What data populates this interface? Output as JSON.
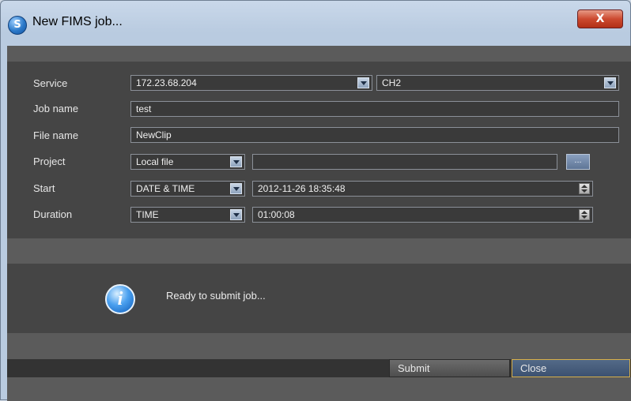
{
  "window": {
    "title": "New FIMS job...",
    "close_glyph": "X",
    "app_icon_glyph": "S"
  },
  "form": {
    "service": {
      "label": "Service",
      "address": "172.23.68.204",
      "channel": "CH2"
    },
    "job_name": {
      "label": "Job name",
      "value": "test"
    },
    "file_name": {
      "label": "File name",
      "value": "NewClip"
    },
    "project": {
      "label": "Project",
      "mode": "Local file",
      "path": "",
      "browse_label": "..."
    },
    "start": {
      "label": "Start",
      "mode": "DATE & TIME",
      "value": "2012-11-26 18:35:48"
    },
    "duration": {
      "label": "Duration",
      "mode": "TIME",
      "value": "01:00:08"
    }
  },
  "status": {
    "icon": "info-icon",
    "message": "Ready to submit job..."
  },
  "buttons": {
    "submit": "Submit",
    "close": "Close"
  },
  "colors": {
    "panel": "#454545",
    "accent_border": "#d8b04a",
    "button_blue": "#3c5170"
  }
}
